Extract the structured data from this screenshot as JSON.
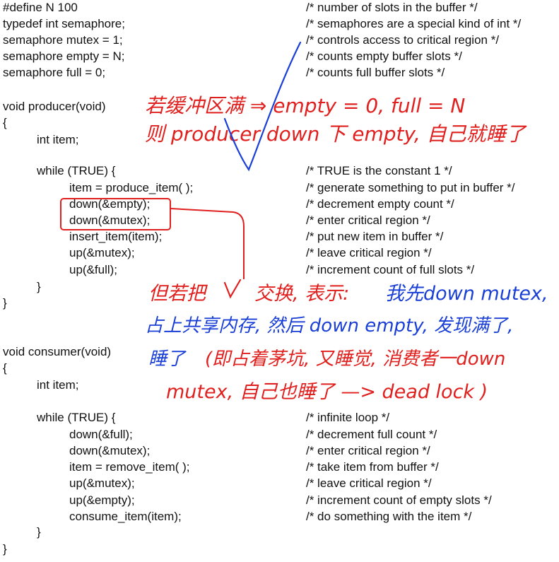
{
  "code": [
    {
      "text": "#define N 100",
      "comment": "/* number of slots in the buffer */"
    },
    {
      "text": "typedef int semaphore;",
      "comment": "/* semaphores are a special kind of int */"
    },
    {
      "text": "semaphore mutex = 1;",
      "comment": "/* controls access to critical region */"
    },
    {
      "text": "semaphore empty = N;",
      "comment": "/* counts empty buffer slots */"
    },
    {
      "text": "semaphore full = 0;",
      "comment": "/* counts full buffer slots */"
    },
    {
      "text": "void producer(void)",
      "comment": ""
    },
    {
      "text": "{",
      "comment": ""
    },
    {
      "text": "int item;",
      "comment": ""
    },
    {
      "text": "while (TRUE) {",
      "comment": "/* TRUE is the constant 1 */"
    },
    {
      "text": "item = produce_item( );",
      "comment": "/* generate something to put in buffer */"
    },
    {
      "text": "down(&empty);",
      "comment": "/* decrement empty count */"
    },
    {
      "text": "down(&mutex);",
      "comment": "/* enter critical region */"
    },
    {
      "text": "insert_item(item);",
      "comment": "/* put new item in buffer */"
    },
    {
      "text": "up(&mutex);",
      "comment": "/* leave critical region */"
    },
    {
      "text": "up(&full);",
      "comment": "/* increment count of full slots */"
    },
    {
      "text": "}",
      "comment": ""
    },
    {
      "text": "}",
      "comment": ""
    },
    {
      "text": "void consumer(void)",
      "comment": ""
    },
    {
      "text": "{",
      "comment": ""
    },
    {
      "text": "int item;",
      "comment": ""
    },
    {
      "text": "while (TRUE) {",
      "comment": "/* infinite loop */"
    },
    {
      "text": "down(&full);",
      "comment": "/* decrement full count */"
    },
    {
      "text": "down(&mutex);",
      "comment": "/* enter critical region */"
    },
    {
      "text": "item = remove_item( );",
      "comment": "/* take item from buffer */"
    },
    {
      "text": "up(&mutex);",
      "comment": "/* leave critical region */"
    },
    {
      "text": "up(&empty);",
      "comment": "/* increment count of empty slots */"
    },
    {
      "text": "consume_item(item);",
      "comment": "/* do something with the item */"
    },
    {
      "text": "}",
      "comment": ""
    },
    {
      "text": "}",
      "comment": ""
    }
  ],
  "notes": {
    "note1_line1": "若缓冲区满 ⇒ empty = 0, full = N",
    "note1_line2": "则 producer down 下 empty, 自己就睡了",
    "note2_line1a": "但若把",
    "note2_line1b": "交换, 表示:",
    "note2_line1c": "我先down mutex,",
    "note2_line2a": "占上共享内存, 然后 down empty, 发现满了,",
    "note2_line3a": "睡了",
    "note2_line3b": "(即占着茅坑, 又睡觉, 消费者一down",
    "note2_line4": "mutex, 自己也睡了 —> dead lock )"
  },
  "colors": {
    "red_ink": "#e0201e",
    "blue_ink": "#1a3fd6"
  }
}
